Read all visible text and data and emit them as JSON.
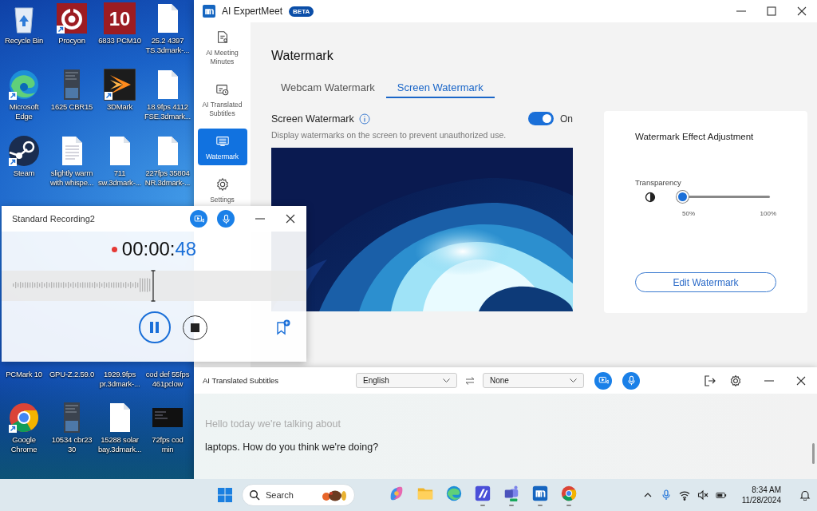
{
  "desktop_top": [
    {
      "label": "Recycle Bin",
      "kind": "recycle",
      "shortcut": false
    },
    {
      "label": "Procyon",
      "kind": "ring",
      "shortcut": true
    },
    {
      "label": "6833 PCM10",
      "kind": "tile",
      "logo_text": "10",
      "shortcut": false
    },
    {
      "label": "25.2 4397\nTS.3dmark-...",
      "kind": "file",
      "shortcut": false
    },
    {
      "label": "Microsoft\nEdge",
      "kind": "edge",
      "shortcut": true
    },
    {
      "label": "1625 CBR15",
      "kind": "thumb",
      "shortcut": false
    },
    {
      "label": "3DMark",
      "kind": "chevrons",
      "shortcut": true
    },
    {
      "label": "18.9fps 4112\nFSE.3dmark...",
      "kind": "file",
      "shortcut": false
    },
    {
      "label": "Steam",
      "kind": "steam",
      "shortcut": true
    },
    {
      "label": "slightly warm\nwith whispe...",
      "kind": "doc",
      "shortcut": false
    },
    {
      "label": "711\nsw.3dmark-...",
      "kind": "file",
      "shortcut": false
    },
    {
      "label": "227fps 35804\nNR.3dmark-...",
      "kind": "file",
      "shortcut": false
    }
  ],
  "desktop_bottom": [
    {
      "label": "PCMark 10"
    },
    {
      "label": "GPU-Z.2.59.0"
    },
    {
      "label": "1929.9fps\npr.3dmark-..."
    },
    {
      "label": "cod def 55fps\n461pclow"
    },
    {
      "label": "Google\nChrome",
      "kind": "chrome",
      "shortcut": true
    },
    {
      "label": "10534 cbr23\n30",
      "kind": "thumb",
      "shortcut": false
    },
    {
      "label": "15288 solar\nbay.3dmark...",
      "kind": "file",
      "shortcut": false
    },
    {
      "label": "72fps cod\nmin",
      "kind": "darkthumb",
      "shortcut": false
    }
  ],
  "main_window": {
    "title": "AI ExpertMeet",
    "badge": "BETA",
    "sidebar": [
      {
        "label": "AI Meeting\nMinutes",
        "kind": "minutes",
        "selected": false
      },
      {
        "label": "AI Translated\nSubtitles",
        "kind": "subtitles",
        "selected": false
      },
      {
        "label": "Watermark",
        "kind": "watermark",
        "selected": true
      },
      {
        "label": "Settings",
        "kind": "settings",
        "selected": false
      }
    ],
    "heading": "Watermark",
    "tabs": [
      {
        "label": "Webcam Watermark",
        "selected": false
      },
      {
        "label": "Screen Watermark",
        "selected": true
      }
    ],
    "setting": {
      "label": "Screen Watermark",
      "on": true,
      "state_label": "On",
      "description": "Display watermarks on the screen to prevent unauthorized use."
    },
    "adjust_card": {
      "title": "Watermark Effect Adjustment",
      "slider_label": "Transparency",
      "level": 0,
      "min_label": "50%",
      "max_label": "100%",
      "button": "Edit Watermark"
    }
  },
  "recording_window": {
    "title": "Standard Recording2",
    "recording": true,
    "timer_prefix": "00:00:",
    "timer_seconds": "48"
  },
  "subtitles_window": {
    "title": "AI Translated Subtitles",
    "source_language": "English",
    "target_language": "None",
    "lines": [
      {
        "text": "Hello today we're talking about",
        "kind": "past"
      },
      {
        "text": "laptops. How do you think we're doing?",
        "kind": "current"
      }
    ]
  },
  "taskbar": {
    "search_placeholder": "Search",
    "apps": [
      {
        "kind": "copilot",
        "running": false
      },
      {
        "kind": "folder",
        "running": false
      },
      {
        "kind": "edge",
        "running": false
      },
      {
        "kind": "bluetile",
        "running": true
      },
      {
        "kind": "teams",
        "running": true
      },
      {
        "kind": "meet",
        "running": true
      },
      {
        "kind": "chrome",
        "running": true
      }
    ],
    "time": "8:34 AM",
    "date": "11/28/2024"
  }
}
